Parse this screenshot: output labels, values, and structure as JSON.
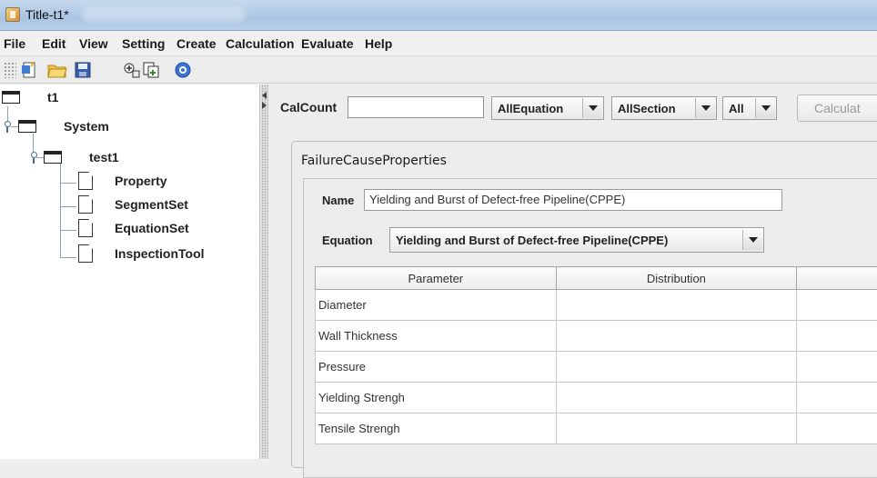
{
  "window": {
    "title": "Title-t1*"
  },
  "menu": [
    "File",
    "Edit",
    "View",
    "Setting",
    "Create",
    "Calculation",
    "Evaluate",
    "Help"
  ],
  "toolbar": {
    "icons": [
      "new-icon",
      "open-folder-icon",
      "save-icon",
      "add-node-icon",
      "copy-icon",
      "help-icon"
    ]
  },
  "tree": {
    "root": "t1",
    "system": "System",
    "project": "test1",
    "children": [
      "Property",
      "SegmentSet",
      "EquationSet",
      "InspectionTool"
    ]
  },
  "controls": {
    "calcount_label": "CalCount",
    "calcount_value": "",
    "equation_filter": "AllEquation",
    "section_filter": "AllSection",
    "all_filter": "All",
    "calculate_label": "Calculat"
  },
  "panel": {
    "title": "FailureCauseProperties",
    "name_label": "Name",
    "name_value": "Yielding and Burst of Defect-free Pipeline(CPPE)",
    "equation_label": "Equation",
    "equation_value": "Yielding and Burst of Defect-free Pipeline(CPPE)"
  },
  "table": {
    "columns": [
      "Parameter",
      "Distribution",
      ""
    ],
    "rows": [
      [
        "Diameter",
        "",
        ""
      ],
      [
        "Wall Thickness",
        "",
        ""
      ],
      [
        "Pressure",
        "",
        ""
      ],
      [
        "Yielding Strengh",
        "",
        ""
      ],
      [
        "Tensile Strengh",
        "",
        ""
      ]
    ]
  }
}
